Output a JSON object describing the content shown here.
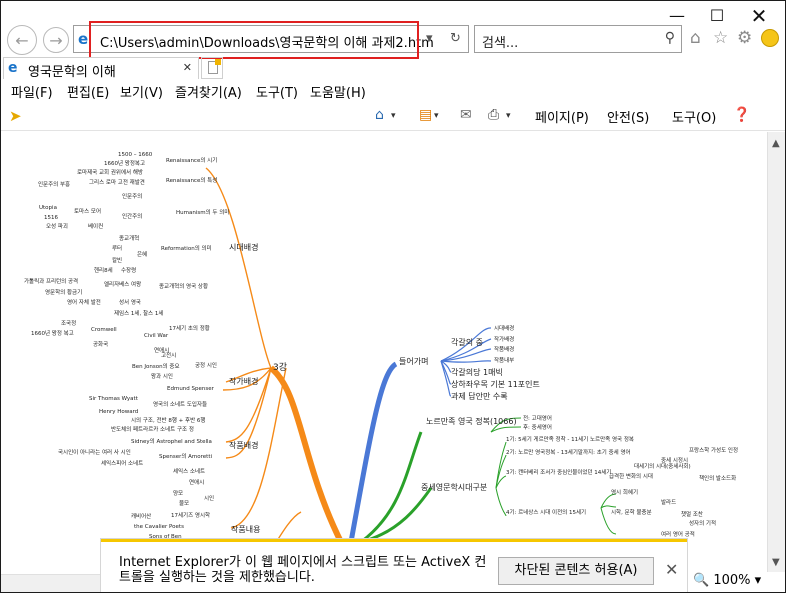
{
  "browser": {
    "address_url": "C:\\Users\\admin\\Downloads\\영국문학의 이해 과제2.htm",
    "search_placeholder": "검색...",
    "tab_title": "영국문학의 이해",
    "window_controls": [
      "minimize",
      "maximize",
      "close"
    ]
  },
  "menu": {
    "file": "파일(F)",
    "edit": "편집(E)",
    "view": "보기(V)",
    "favorites": "즐겨찾기(A)",
    "tools": "도구(T)",
    "help": "도움말(H)"
  },
  "commandbar": {
    "page": "페이지(P)",
    "safety": "안전(S)",
    "tools": "도구(O)"
  },
  "mindmap": {
    "center_top": "3강",
    "intro": {
      "label": "들어가며",
      "items": [
        "각갈의 중",
        "각갈의당 1매빅",
        "상하좌우목 기본 11포인트",
        "과제 답안만 수록"
      ],
      "subitems": [
        "시대배경",
        "작가배경",
        "작품배경",
        "작품내부"
      ]
    },
    "branches": {
      "era": "시대배경",
      "author": "작가배경",
      "work": "작품배경",
      "content": "작품내용"
    },
    "era_nodes": [
      "1500 – 1660",
      "1660년 왕정복고",
      "Renaissance의 시기",
      "로마제국 교회 권위에서 해방",
      "그리스 로마 고전 재발견",
      "인문주의 부흥",
      "Renaissance의 특성",
      "인문주의",
      "Utopia",
      "토마스 모어",
      "1516",
      "오성 파괴",
      "베이컨",
      "Humanism의 두 의미",
      "인간주의",
      "종교개혁",
      "루터",
      "칼빈",
      "Reformation의 의미",
      "은혜",
      "헨리8세",
      "수장령",
      "엘리자베스 여왕",
      "가톨릭과 프리턴의 공격",
      "영문학의 황금기",
      "영어 자체 발전",
      "성서 영국",
      "제임스 1세, 찰스 1세",
      "종교개혁의 영국 상황",
      "조국정",
      "1660년 왕정 복고",
      "Cromwell",
      "공화국",
      "Civil War",
      "17세기 초의 정황"
    ],
    "author_nodes": [
      "연애시",
      "고전시",
      "Ben Jonson의 중요",
      "궁정 시인",
      "왕과 시인",
      "Edmund Spenser",
      "Sir Thomas Wyatt",
      "Henry Howard",
      "영국의 소네트 도입자들"
    ],
    "work_nodes": [
      "시의 구조, 전반 8행 + 후반 6행",
      "반도체의 페트라르카 소네트 구조 정",
      "Sidney의 Astrophel and Stella",
      "국시인이 아니라는 여러 사 시인",
      "Spenser의 Amoretti",
      "셰익스피어 소네트",
      "현재 다방",
      "셰익스 소네트"
    ],
    "content_nodes": [
      "연애시",
      "양모",
      "물모",
      "시인",
      "현재",
      "캐비어산",
      "17세기즈 영시학",
      "the Cavalier Poets",
      "Sons of Ben"
    ],
    "history": {
      "label": "중세영문학시대구분",
      "root": "노르만족 영국 정복(1066)",
      "items": [
        "전: 고대영어",
        "후: 중세영어",
        "1기: 5세기 게르만족 정착 - 11세기 노르만족 영국 정복",
        "2기: 노르만 영국정복 - 13세기말까지: 초기 중세 영어",
        "3기: 캔터베리 조서가 중심인물이었던 14세기",
        "4기: 르네상스 시대 이전의 15세기",
        "대세기의 시대(중세사회)",
        "급격한 변화의 시대",
        "프랑스학 가성도 인정",
        "중세 시정시",
        "책인의 발소드화",
        "영시 희혜기",
        "시학, 문학 불충분",
        "발라드",
        "챗멀 조찬",
        "성자의 기적",
        "여러 영어 공적"
      ]
    }
  },
  "infobar": {
    "message": "Internet Explorer가 이 웹 페이지에서 스크립트 또는 ActiveX 컨트롤을 실행하는 것을 제한했습니다.",
    "allow_button": "차단된 콘텐츠 허용(A)"
  },
  "status": {
    "zoom": "100%"
  }
}
